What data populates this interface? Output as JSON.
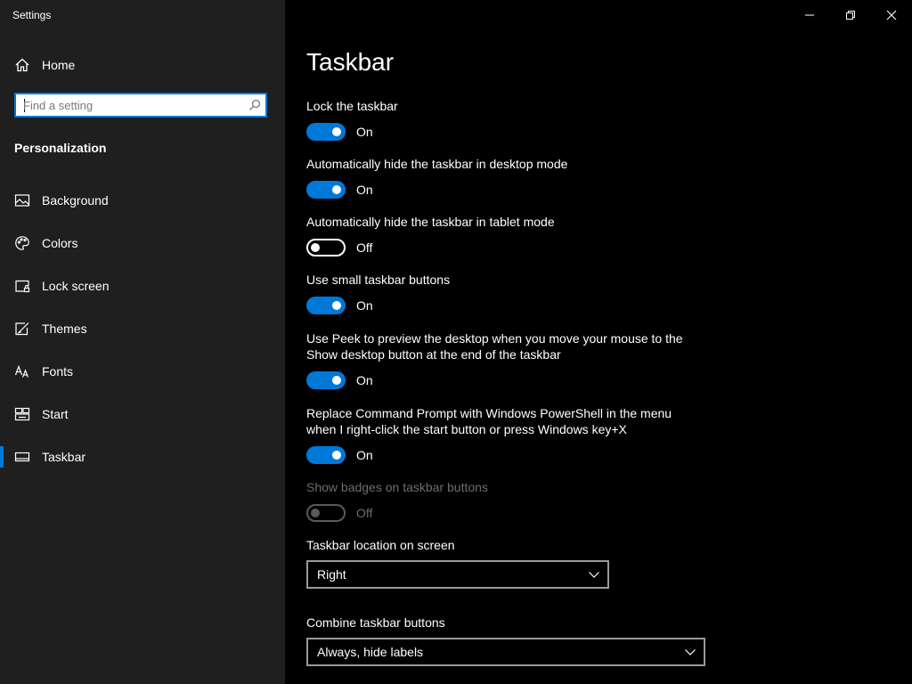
{
  "app": {
    "title": "Settings"
  },
  "sidebar": {
    "home_label": "Home",
    "search": {
      "placeholder": "Find a setting"
    },
    "section_title": "Personalization",
    "items": [
      {
        "label": "Background",
        "icon": "picture-icon"
      },
      {
        "label": "Colors",
        "icon": "palette-icon"
      },
      {
        "label": "Lock screen",
        "icon": "lock-screen-icon"
      },
      {
        "label": "Themes",
        "icon": "paintbrush-icon"
      },
      {
        "label": "Fonts",
        "icon": "font-icon"
      },
      {
        "label": "Start",
        "icon": "start-icon"
      },
      {
        "label": "Taskbar",
        "icon": "taskbar-icon",
        "selected": true
      }
    ]
  },
  "window_controls": [
    "minimize",
    "restore",
    "close"
  ],
  "main": {
    "title": "Taskbar",
    "settings": [
      {
        "label": "Lock the taskbar",
        "state": "On",
        "enabled": true
      },
      {
        "label": "Automatically hide the taskbar in desktop mode",
        "state": "On",
        "enabled": true
      },
      {
        "label": "Automatically hide the taskbar in tablet mode",
        "state": "Off",
        "enabled": true
      },
      {
        "label": "Use small taskbar buttons",
        "state": "On",
        "enabled": true
      },
      {
        "label": "Use Peek to preview the desktop when you move your mouse to the Show desktop button at the end of the taskbar",
        "state": "On",
        "enabled": true
      },
      {
        "label": "Replace Command Prompt with Windows PowerShell in the menu when I right-click the start button or press Windows key+X",
        "state": "On",
        "enabled": true
      },
      {
        "label": "Show badges on taskbar buttons",
        "state": "Off",
        "enabled": false
      }
    ],
    "location": {
      "label": "Taskbar location on screen",
      "value": "Right"
    },
    "combine": {
      "label": "Combine taskbar buttons",
      "value": "Always, hide labels"
    }
  },
  "colors": {
    "accent": "#0078d7",
    "sidebar_bg": "#1f1f1f",
    "main_bg": "#000000",
    "disabled_text": "#6d6d6d"
  }
}
